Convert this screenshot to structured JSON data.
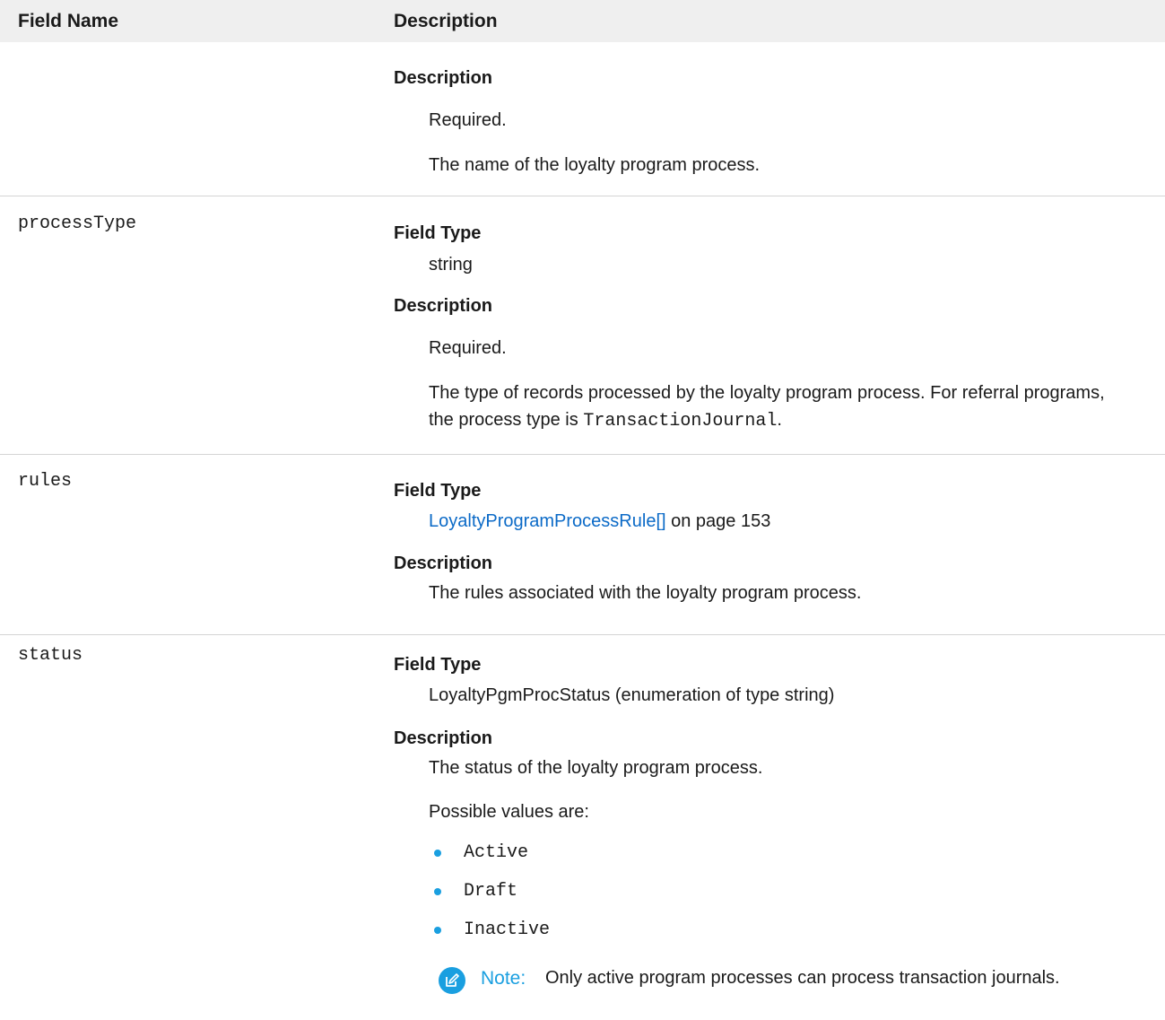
{
  "header": {
    "field_name": "Field Name",
    "description": "Description"
  },
  "rows": [
    {
      "description_label": "Description",
      "required": "Required.",
      "description": "The name of the loyalty program process."
    },
    {
      "field": "processType",
      "field_type_label": "Field Type",
      "field_type": "string",
      "description_label": "Description",
      "required": "Required.",
      "description_line1": "The type of records processed by the loyalty program process. For referral programs,",
      "description_line2_prefix": "the process type is ",
      "description_code": "TransactionJournal",
      "description_line2_suffix": "."
    },
    {
      "field": "rules",
      "field_type_label": "Field Type",
      "field_type_link": "LoyaltyProgramProcessRule[]",
      "field_type_suffix": " on page 153",
      "description_label": "Description",
      "description": "The rules associated with the loyalty program process."
    },
    {
      "field": "status",
      "field_type_label": "Field Type",
      "field_type": "LoyaltyPgmProcStatus (enumeration of type string)",
      "description_label": "Description",
      "description": "The status of the loyalty program process.",
      "values_intro": "Possible values are:",
      "values": [
        "Active",
        "Draft",
        "Inactive"
      ],
      "note_label": "Note:",
      "note_text": "Only active program processes can process transaction journals."
    }
  ],
  "colors": {
    "link": "#0b6ac7",
    "accent": "#1a9fe0",
    "header_bg": "#efefef",
    "divider": "#d4d4d4"
  }
}
